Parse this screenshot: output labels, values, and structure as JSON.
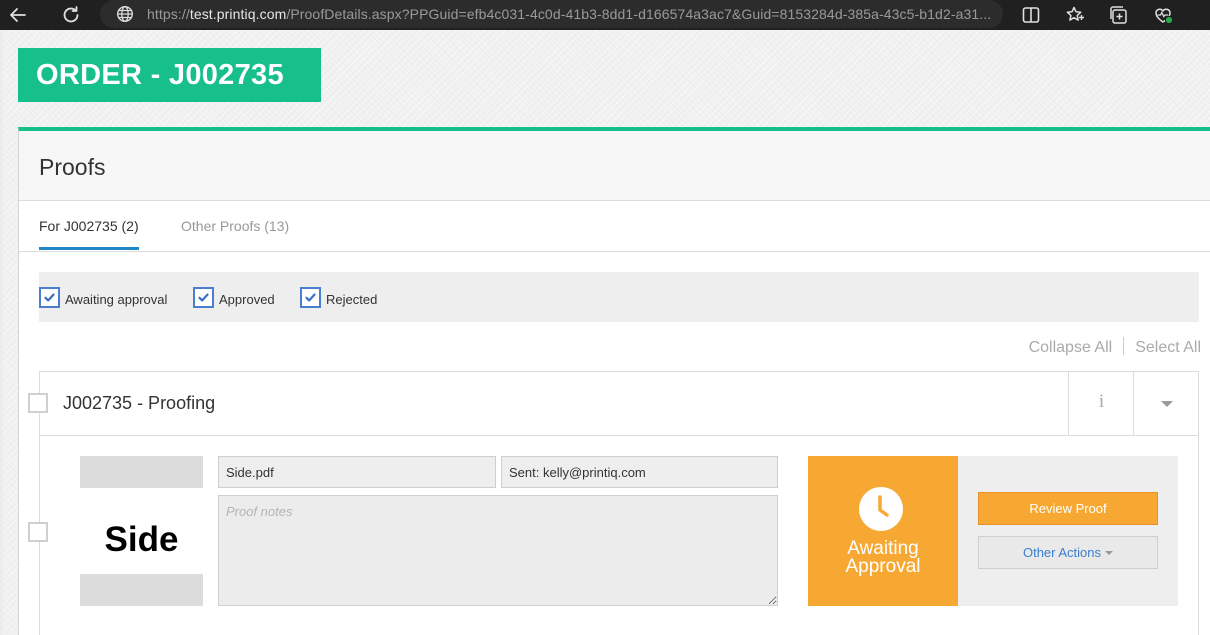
{
  "browser": {
    "url_prefix": "https://",
    "url_host": "test.printiq.com",
    "url_rest": "/ProofDetails.aspx?PPGuid=efb4c031-4c0d-41b3-8dd1-d166574a3ac7&Guid=8153284d-385a-43c5-b1d2-a31..."
  },
  "order": {
    "title": "ORDER - J002735"
  },
  "panel": {
    "title": "Proofs",
    "tabs": [
      {
        "label": "For J002735 (2)",
        "active": true
      },
      {
        "label": "Other Proofs (13)",
        "active": false
      }
    ],
    "filters": [
      {
        "label": "Awaiting approval",
        "checked": true
      },
      {
        "label": "Approved",
        "checked": true
      },
      {
        "label": "Rejected",
        "checked": true
      }
    ],
    "collapse_all": "Collapse All",
    "select_all": "Select All"
  },
  "proof_group": {
    "title": "J002735 - Proofing",
    "info_icon_glyph": "i",
    "item": {
      "thumbnail_text": "Side",
      "file_name": "Side.pdf",
      "sent": "Sent: kelly@printiq.com",
      "notes_placeholder": "Proof notes",
      "status": "Awaiting Approval",
      "status_color": "#f7a833",
      "review_button": "Review Proof",
      "other_actions_button": "Other Actions"
    }
  },
  "colors": {
    "brand_green": "#17bf8a",
    "link_blue": "#3b7fd0",
    "tab_underline": "#1e87c7"
  }
}
